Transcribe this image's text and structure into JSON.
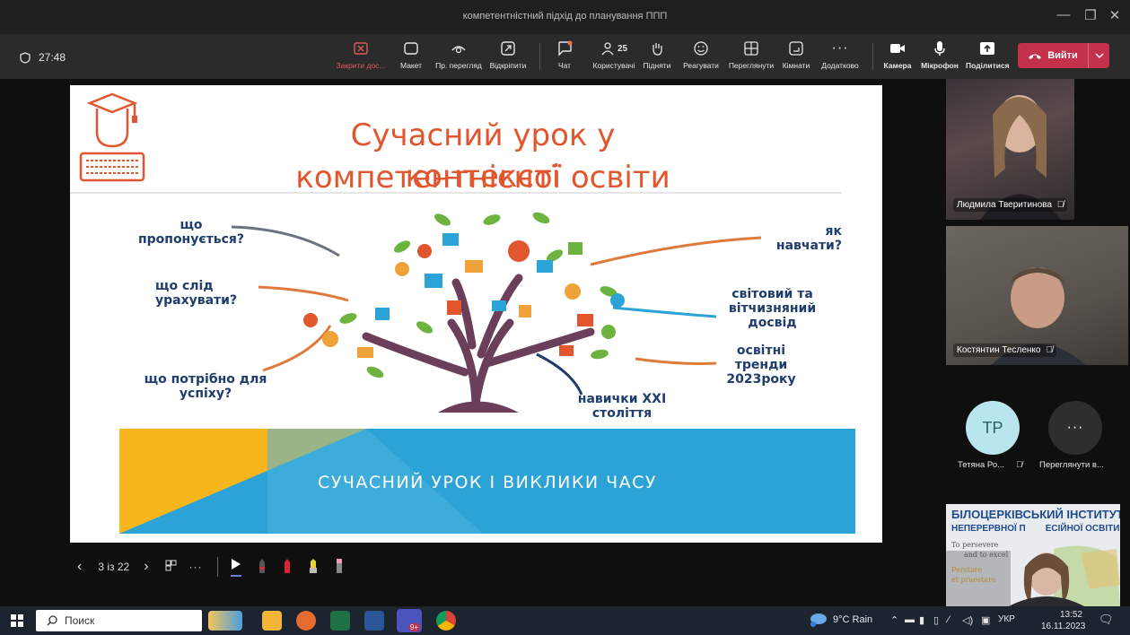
{
  "window": {
    "title": "компетентністний підхід до планування ППП"
  },
  "meeting": {
    "timer": "27:48",
    "toolbar": {
      "close_share": "Закрити дос...",
      "layout": "Макет",
      "preview": "Пр. перегляд",
      "unpin": "Відкріпити",
      "chat": "Чат",
      "participants": "Користувачі",
      "participants_count": "25",
      "raise": "Підняти",
      "react": "Реагувати",
      "view": "Переглянути",
      "rooms": "Кімнати",
      "more": "Додатково",
      "camera": "Камера",
      "mic": "Мікрофон",
      "share": "Поділитися",
      "leave": "Вийти"
    }
  },
  "slide": {
    "title_line1": "Сучасний урок у контексті",
    "title_line2": "компетентнісної освіти",
    "q1_line1": "що",
    "q1_line2": "пропонується?",
    "q2_line1": "що слід",
    "q2_line2": "урахувати?",
    "q3_line1": "що потрібно для",
    "q3_line2": "успіху?",
    "q4_line1": "навички XXI",
    "q4_line2": "століття",
    "q5_line1": "як",
    "q5_line2": "навчати?",
    "q6_line1": "світовий та",
    "q6_line2": "вітчизняний",
    "q6_line3": "досвід",
    "q7_line1": "освітні",
    "q7_line2": "тренди",
    "q7_line3": "2023року",
    "banner": "СУЧАСНИЙ УРОК І ВИКЛИКИ ЧАСУ"
  },
  "presenter_bar": {
    "page": "3 із 22"
  },
  "participants": [
    {
      "name": "Людмила Тверитинова"
    },
    {
      "name": "Костянтин Тесленко"
    },
    {
      "initials": "TP",
      "name": "Тетяна Ро..."
    },
    {
      "name": "Переглянути в..."
    }
  ],
  "institute": {
    "line1": "БІЛОЦЕРКІВСЬКИЙ ІНСТИТУТ",
    "line2_a": "НЕПЕРЕРВНОЇ П",
    "line2_b": "ЕСІЙНОЇ ОСВІТИ",
    "motto1": "To persevere",
    "motto2": "and to excel",
    "motto3": "Perstare",
    "motto4": "et praestare"
  },
  "taskbar": {
    "search_placeholder": "Поиск",
    "weather": "9°C Rain",
    "lang": "УКР",
    "time": "13:52",
    "date": "16.11.2023",
    "teams_badge": "9+"
  },
  "colors": {
    "slide_title": "#e2562e",
    "slide_text": "#1f3c6e",
    "banner": "#2ba3d6",
    "leave": "#c4314b",
    "avatar": "#b9e5ee"
  }
}
